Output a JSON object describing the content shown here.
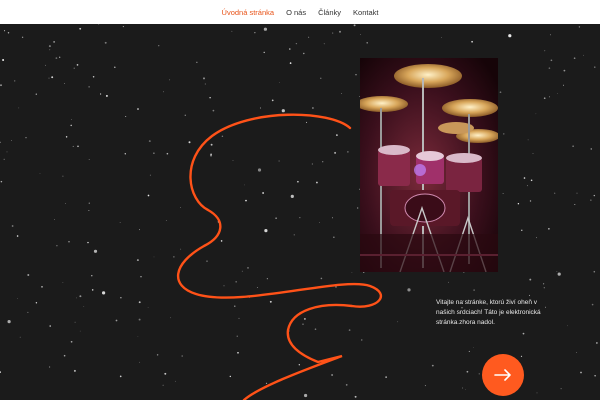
{
  "nav": {
    "items": [
      {
        "label": "Úvodná stránka",
        "active": true
      },
      {
        "label": "O nás",
        "active": false
      },
      {
        "label": "Články",
        "active": false
      },
      {
        "label": "Kontakt",
        "active": false
      }
    ]
  },
  "hero": {
    "welcome_text": "Vitajte na stránke, ktorú živí oheň v našich srdciach! Táto je elektronická stránka zhora nadol.",
    "photo_subject": "drum-kit-on-stage",
    "cta_icon": "arrow-right-icon"
  },
  "colors": {
    "accent": "#ff5a1f",
    "nav_active": "#e8541a",
    "background": "#1b1b1b",
    "nav_bg": "#ffffff"
  }
}
